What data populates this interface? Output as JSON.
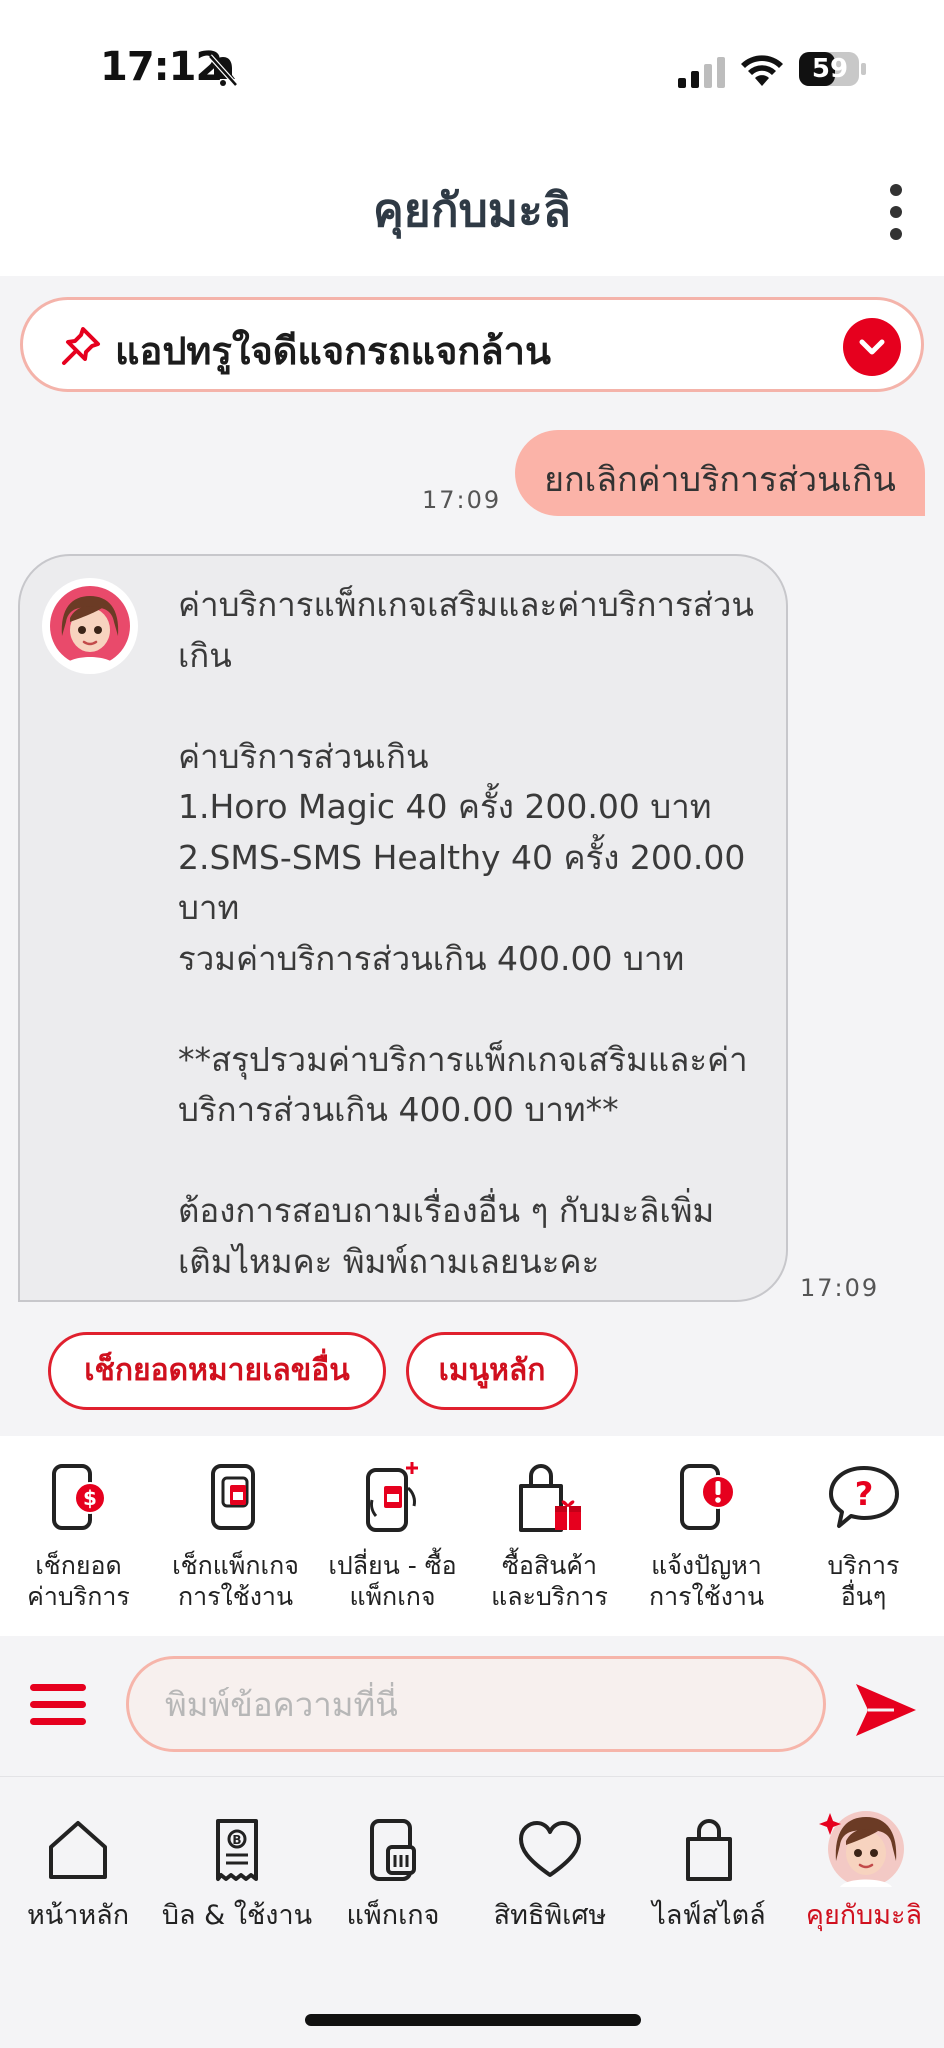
{
  "status_bar": {
    "time": "17:12",
    "battery": "59"
  },
  "header": {
    "title": "คุยกับมะลิ"
  },
  "announcement": {
    "text": "แอปทรูใจดีแจกรถแจกล้าน"
  },
  "chat": {
    "user_message": {
      "text": "ยกเลิกค่าบริการส่วนเกิน",
      "time": "17:09"
    },
    "bot_message": {
      "lines": [
        "ค่าบริการแพ็กเกจเสริมและค่าบริการส่วน",
        "เกิน",
        "",
        "ค่าบริการส่วนเกิน",
        "1.Horo Magic 40 ครั้ง 200.00 บาท",
        "2.SMS-SMS Healthy 40 ครั้ง 200.00",
        "บาท",
        "รวมค่าบริการส่วนเกิน 400.00 บาท",
        "",
        "**สรุปรวมค่าบริการแพ็กเกจเสริมและค่า",
        "บริการส่วนเกิน 400.00 บาท**",
        "",
        "ต้องการสอบถามเรื่องอื่น ๆ กับมะลิเพิ่ม",
        "เติมไหมคะ พิมพ์ถามเลยนะคะ"
      ],
      "time": "17:09"
    }
  },
  "quick_replies": [
    "เช็กยอดหมายเลขอื่น",
    "เมนูหลัก"
  ],
  "service_menu": [
    {
      "icon": "phone-bill-icon",
      "line1": "เช็กยอด",
      "line2": "ค่าบริการ"
    },
    {
      "icon": "phone-package-icon",
      "line1": "เช็กแพ็กเกจ",
      "line2": "การใช้งาน"
    },
    {
      "icon": "phone-swap-icon",
      "line1": "เปลี่ยน - ซื้อ",
      "line2": "แพ็กเกจ"
    },
    {
      "icon": "shopping-bag-gift-icon",
      "line1": "ซื้อสินค้า",
      "line2": "และบริการ"
    },
    {
      "icon": "phone-alert-icon",
      "line1": "แจ้งปัญหา",
      "line2": "การใช้งาน"
    },
    {
      "icon": "question-bubble-icon",
      "line1": "บริการ",
      "line2": "อื่นๆ"
    }
  ],
  "input": {
    "placeholder": "พิมพ์ข้อความที่นี่"
  },
  "bottom_nav": [
    {
      "icon": "home-icon",
      "label": "หน้าหลัก"
    },
    {
      "icon": "bill-icon",
      "label": "บิล & ใช้งาน"
    },
    {
      "icon": "package-icon",
      "label": "แพ็กเกจ"
    },
    {
      "icon": "heart-icon",
      "label": "สิทธิพิเศษ"
    },
    {
      "icon": "bag-icon",
      "label": "ไลฟ์สไตล์"
    },
    {
      "icon": "mali-avatar-icon",
      "label": "คุยกับมะลิ",
      "active": true
    }
  ],
  "colors": {
    "brand_red": "#e6001e",
    "bubble_user": "#fbb3a8",
    "bubble_bot": "#ececee"
  }
}
